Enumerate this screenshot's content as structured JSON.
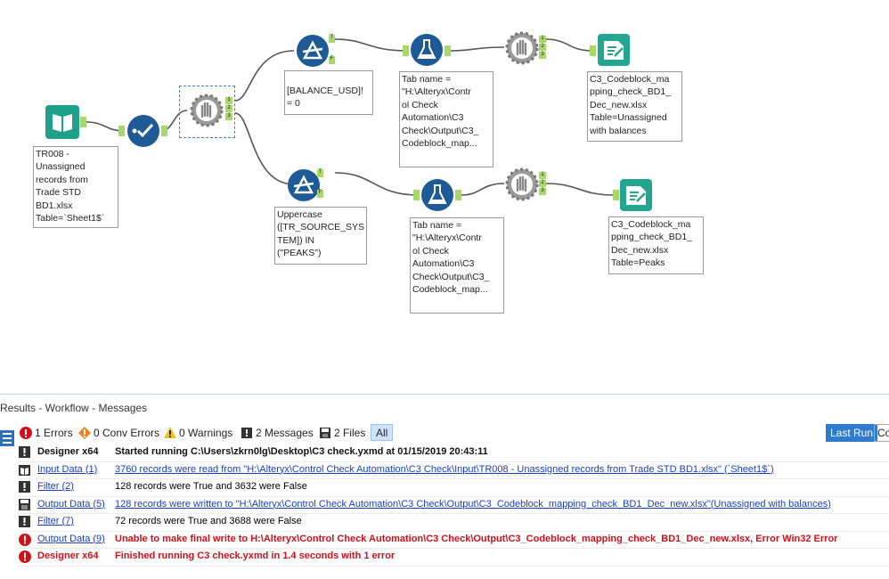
{
  "workflow": {
    "input_label": "TR008 -\nUnassigned\nrecords from\nTrade STD\nBD1.xlsx\nTable=`Sheet1$`",
    "filter1_label": "[BALANCE_USD]!\n= 0",
    "filter2_label": "Uppercase\n([TR_SOURCE_SYS\nTEM]) IN\n(\"PEAKS\")",
    "formula1_label": "Tab name =\n\"H:\\Alteryx\\Contr\nol Check\nAutomation\\C3\nCheck\\Output\\C3_\nCodeblock_map...",
    "formula2_label": "Tab name =\n\"H:\\Alteryx\\Contr\nol Check\nAutomation\\C3\nCheck\\Output\\C3_\nCodeblock_map...",
    "output1_label": "C3_Codeblock_ma\npping_check_BD1_\nDec_new.xlsx\nTable=Unassigned\nwith balances",
    "output2_label": "C3_Codeblock_ma\npping_check_BD1_\nDec_new.xlsx\nTable=Peaks",
    "anchors": {
      "t": "T",
      "f": "F",
      "n1": "1",
      "n2": "2",
      "n3": "3"
    }
  },
  "results": {
    "title": "Results - Workflow - Messages",
    "toolbar": {
      "errors": "1 Errors",
      "conv_errors": "0 Conv Errors",
      "warnings": "0 Warnings",
      "messages": "2 Messages",
      "files": "2 Files",
      "all": "All",
      "last_run": "Last Run",
      "cut_button": "Co"
    },
    "rows": [
      {
        "icon": "message-icon",
        "source": "Designer x64",
        "source_style": "bold",
        "message": "Started running C:\\Users\\zkrn0lg\\Desktop\\C3 check.yxmd at 01/15/2019 20:43:11",
        "message_style": "bold"
      },
      {
        "icon": "input-data-icon",
        "source": "Input Data (1)",
        "source_style": "link",
        "message": "3760 records were read from \"H:\\Alteryx\\Control Check Automation\\C3 Check\\Input\\TR008 - Unassigned records from Trade STD BD1.xlsx\" (`Sheet1$`)",
        "message_style": "link"
      },
      {
        "icon": "message-icon",
        "source": "Filter (2)",
        "source_style": "link",
        "message": "128 records were True and 3632 were False",
        "message_style": "plain"
      },
      {
        "icon": "output-data-icon",
        "source": "Output Data (5)",
        "source_style": "link",
        "message": "128 records were written to \"H:\\Alteryx\\Control Check Automation\\C3 Check\\Output\\C3_Codeblock_mapping_check_BD1_Dec_new.xlsx\"(Unassigned with balances)",
        "message_style": "link"
      },
      {
        "icon": "message-icon",
        "source": "Filter (7)",
        "source_style": "link",
        "message": "72 records were True and 3688 were False",
        "message_style": "plain"
      },
      {
        "icon": "error-icon",
        "source": "Output Data (9)",
        "source_style": "link",
        "message": "Unable to make final write to H:\\Alteryx\\Control Check Automation\\C3 Check\\Output\\C3_Codeblock_mapping_check_BD1_Dec_new.xlsx, Error Win32 Error",
        "message_style": "err"
      },
      {
        "icon": "error-icon",
        "source": "Designer x64",
        "source_style": "err",
        "message": "Finished running C3 check.yxmd in 1.4 seconds with 1 error",
        "message_style": "err"
      }
    ]
  },
  "colors": {
    "input_green": "#1fa08a",
    "output_green": "#23a58f",
    "filter_blue": "#1d5a96",
    "formula_blue": "#1d5a96",
    "accent": "#3b7fd4",
    "error": "#d1101a",
    "warning": "#f0a020",
    "connector": "#555555",
    "anchor_green": "#a8d86a"
  }
}
